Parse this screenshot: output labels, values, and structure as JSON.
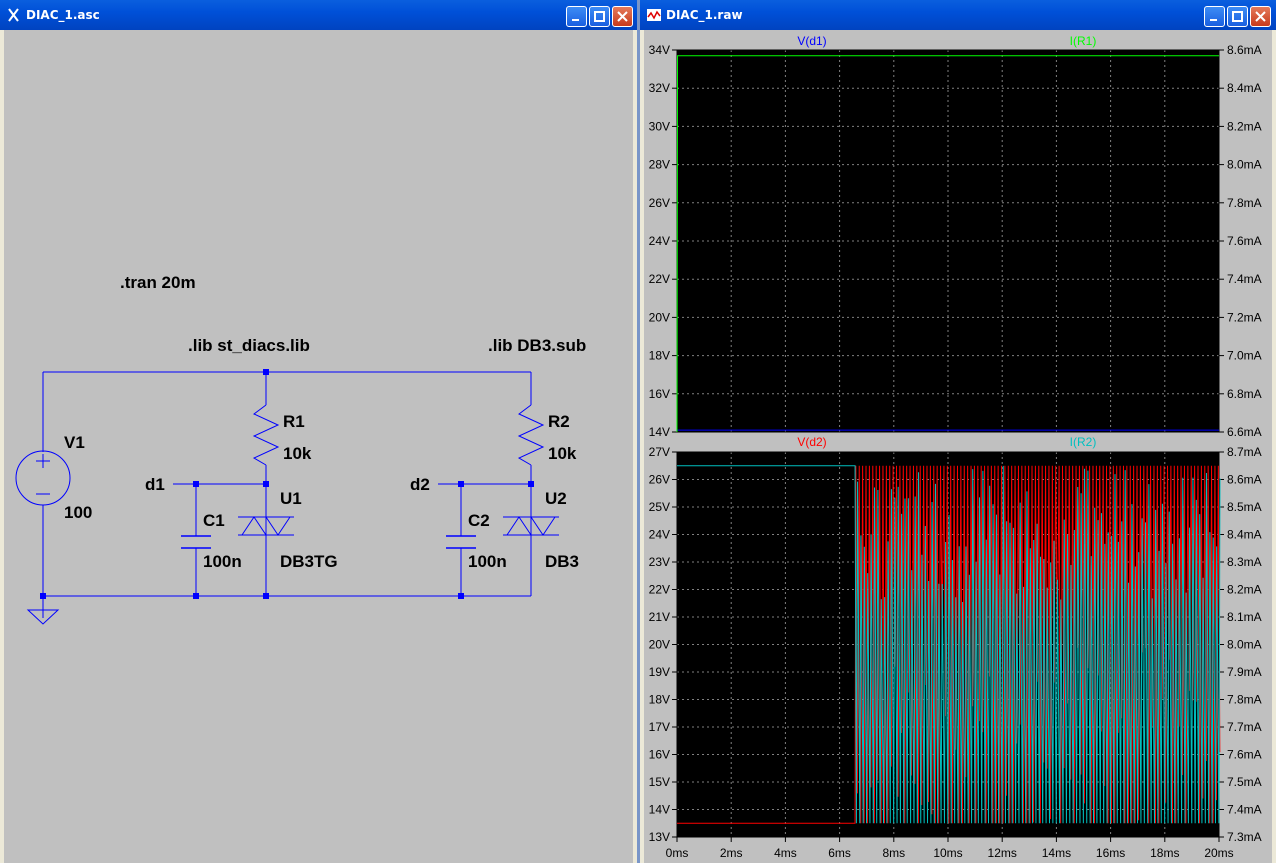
{
  "schematic_window": {
    "title": "DIAC_1.asc",
    "directives": {
      "tran": ".tran 20m",
      "lib1": ".lib st_diacs.lib",
      "lib2": ".lib DB3.sub"
    },
    "components": {
      "V1": {
        "name": "V1",
        "value": "100"
      },
      "R1": {
        "name": "R1",
        "value": "10k"
      },
      "R2": {
        "name": "R2",
        "value": "10k"
      },
      "C1": {
        "name": "C1",
        "value": "100n"
      },
      "C2": {
        "name": "C2",
        "value": "100n"
      },
      "U1": {
        "name": "U1",
        "value": "DB3TG"
      },
      "U2": {
        "name": "U2",
        "value": "DB3"
      }
    },
    "nets": {
      "d1": "d1",
      "d2": "d2"
    },
    "colors": {
      "background": "#c0c0c0",
      "wire": "#0000ff",
      "text": "#000000"
    }
  },
  "waveform_window": {
    "title": "DIAC_1.raw",
    "colors": {
      "plot_bg": "#000000",
      "grid": "#808080",
      "v_d1": "#0000ff",
      "i_r1": "#00ff00",
      "v_d2": "#ff0000",
      "i_r2": "#00c0c0"
    },
    "x_ticks": [
      "0ms",
      "2ms",
      "4ms",
      "6ms",
      "8ms",
      "10ms",
      "12ms",
      "14ms",
      "16ms",
      "18ms",
      "20ms"
    ]
  },
  "chart_data": [
    {
      "type": "line",
      "series": [
        {
          "name": "V(d1)",
          "axis": "left",
          "unit": "V",
          "x_ms": [
            0,
            0.0,
            20
          ],
          "values": [
            14.1,
            14.1,
            14.1
          ]
        },
        {
          "name": "I(R1)",
          "axis": "right",
          "unit": "mA",
          "x_ms": [
            0,
            0.02,
            20
          ],
          "values": [
            6.6,
            8.57,
            8.57
          ]
        }
      ],
      "xlim_ms": [
        0,
        20
      ],
      "left_ylim": [
        14,
        34
      ],
      "left_ticks": [
        "14V",
        "16V",
        "18V",
        "20V",
        "22V",
        "24V",
        "26V",
        "28V",
        "30V",
        "32V",
        "34V"
      ],
      "right_ylim": [
        6.6,
        8.6
      ],
      "right_ticks": [
        "6.6mA",
        "6.8mA",
        "7.0mA",
        "7.2mA",
        "7.4mA",
        "7.6mA",
        "7.8mA",
        "8.0mA",
        "8.2mA",
        "8.4mA",
        "8.6mA"
      ],
      "grid": true
    },
    {
      "type": "line",
      "series": [
        {
          "name": "V(d2)",
          "axis": "left",
          "unit": "V",
          "description_points": {
            "x_ms": [
              0,
              6.5,
              6.6,
              20
            ],
            "values": [
              13.5,
              13.5,
              26.5,
              26.5
            ]
          },
          "oscillation_range_after_6.6ms": [
            13.5,
            26.5
          ]
        },
        {
          "name": "I(R2)",
          "axis": "right",
          "unit": "mA",
          "description_points": {
            "x_ms": [
              0,
              6.5,
              6.6,
              20
            ],
            "values": [
              8.65,
              8.65,
              7.35,
              8.65
            ]
          },
          "oscillation_range_after_6.6ms": [
            7.35,
            8.65
          ]
        }
      ],
      "xlim_ms": [
        0,
        20
      ],
      "left_ylim": [
        13,
        27
      ],
      "left_ticks": [
        "13V",
        "14V",
        "15V",
        "16V",
        "17V",
        "18V",
        "19V",
        "20V",
        "21V",
        "22V",
        "23V",
        "24V",
        "25V",
        "26V",
        "27V"
      ],
      "right_ylim": [
        7.3,
        8.7
      ],
      "right_ticks": [
        "7.3mA",
        "7.4mA",
        "7.5mA",
        "7.6mA",
        "7.7mA",
        "7.8mA",
        "7.9mA",
        "8.0mA",
        "8.1mA",
        "8.2mA",
        "8.3mA",
        "8.4mA",
        "8.5mA",
        "8.6mA",
        "8.7mA"
      ],
      "grid": true
    }
  ]
}
